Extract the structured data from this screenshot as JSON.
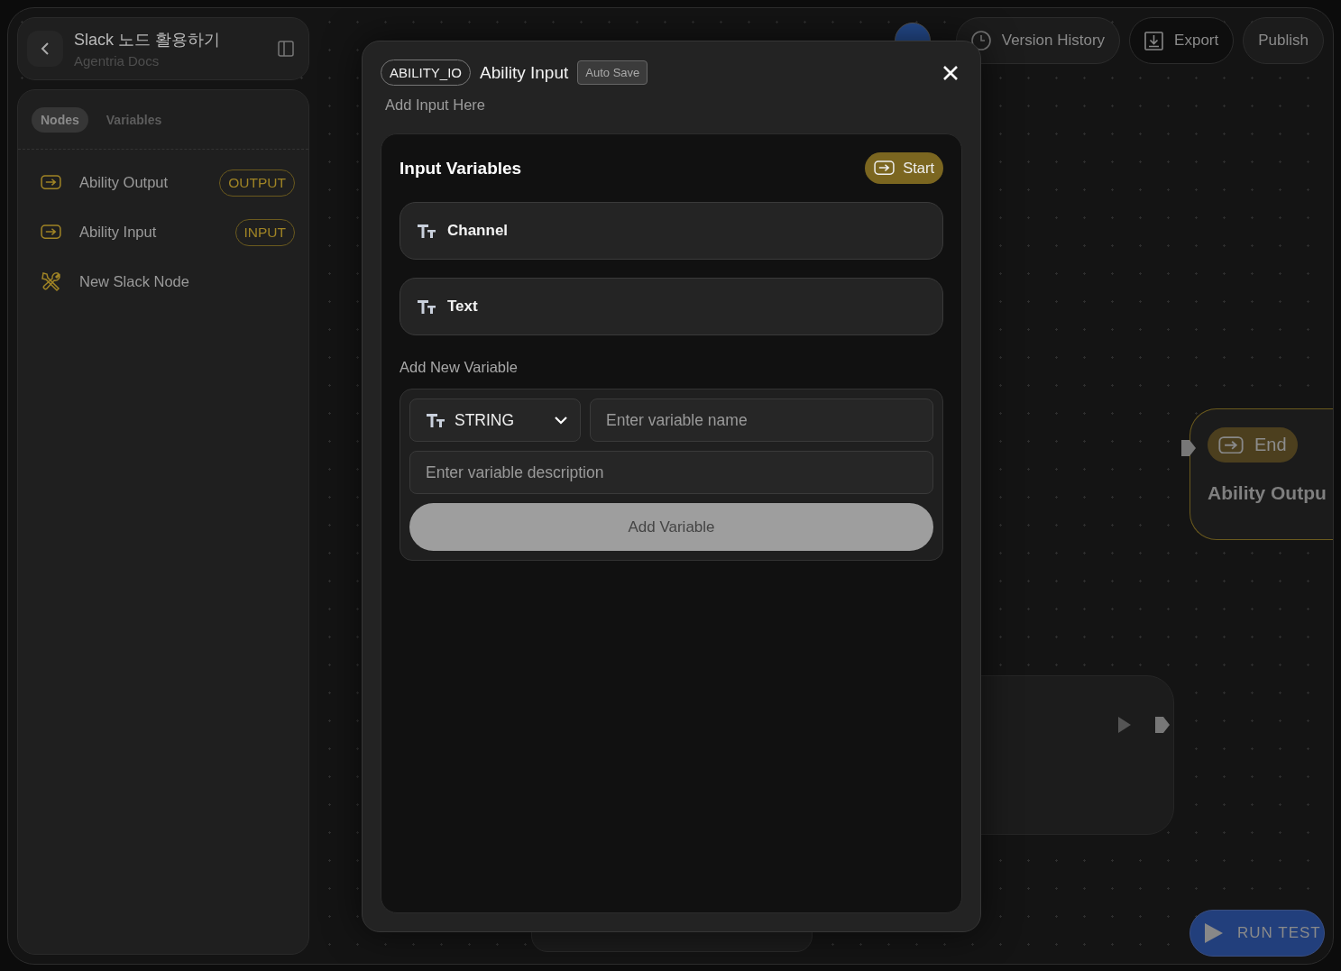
{
  "header": {
    "title": "Slack 노드 활용하기",
    "subtitle": "Agentria Docs"
  },
  "sidebar": {
    "tabs": [
      {
        "label": "Nodes",
        "selected": true
      },
      {
        "label": "Variables",
        "selected": false
      }
    ],
    "items": [
      {
        "label": "Ability Output",
        "badge": "OUTPUT",
        "kind": "io"
      },
      {
        "label": "Ability Input",
        "badge": "INPUT",
        "kind": "io"
      },
      {
        "label": "New Slack Node",
        "kind": "tool"
      }
    ]
  },
  "toolbar": {
    "buttons": [
      {
        "label": "Version History",
        "kind": "history"
      },
      {
        "label": "Export",
        "kind": "export"
      },
      {
        "label": "Publish",
        "kind": "plain"
      }
    ]
  },
  "modal": {
    "tag": "ABILITY_IO",
    "title": "Ability Input",
    "badge": "Auto Save",
    "subtitle": "Add Input Here",
    "section_title": "Input Variables",
    "start": "Start",
    "variables": [
      {
        "name": "Channel"
      },
      {
        "name": "Text"
      }
    ],
    "add_new": {
      "label": "Add New Variable",
      "type": "STRING",
      "name_placeholder": "Enter variable name",
      "description_placeholder": "Enter variable description",
      "button": "Add Variable"
    }
  },
  "canvas": {
    "end_node": {
      "badge": "End",
      "title": "Ability Outpu"
    },
    "run_button": "RUN TEST"
  }
}
